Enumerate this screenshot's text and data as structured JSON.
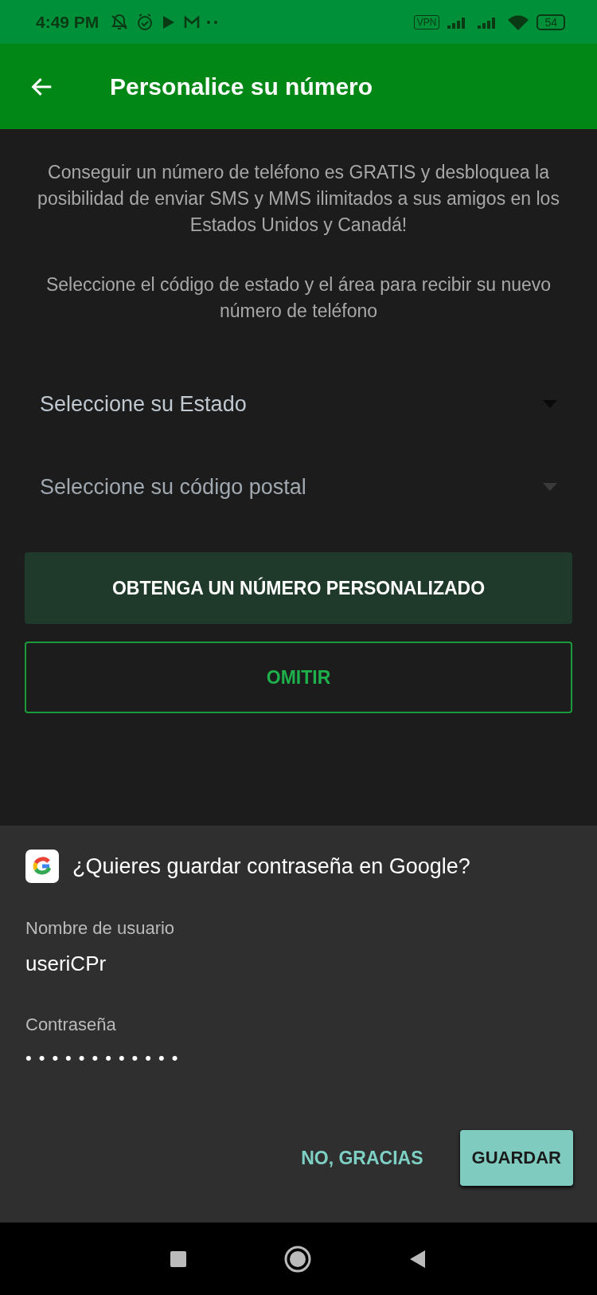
{
  "status_bar": {
    "time": "4:49 PM",
    "vpn": "VPN",
    "battery": "54"
  },
  "app_bar": {
    "title": "Personalice su número"
  },
  "intro": "Conseguir un número de teléfono es GRATIS y desbloquea la posibilidad de enviar SMS y MMS ilimitados a sus amigos en los Estados Unidos y Canadá!",
  "instructions": "Seleccione el código de estado y el área para recibir su nuevo número de teléfono",
  "dropdowns": [
    {
      "placeholder": "Seleccione su Estado",
      "disabled": false
    },
    {
      "placeholder": "Seleccione su código postal",
      "disabled": true
    }
  ],
  "buttons": [
    {
      "label": "OBTENGA UN NÚMERO PERSONALIZADO",
      "kind": "filled"
    },
    {
      "label": "OMITIR",
      "kind": "outlined"
    }
  ],
  "save_sheet": {
    "title": "¿Quieres guardar contraseña en Google?",
    "username_label": "Nombre de usuario",
    "username": "useriCPr",
    "password_label": "Contraseña",
    "password": "••••••••••••",
    "buttons": [
      {
        "label": "NO, GRACIAS",
        "kind": "text"
      },
      {
        "label": "GUARDAR",
        "kind": "filled"
      }
    ]
  }
}
